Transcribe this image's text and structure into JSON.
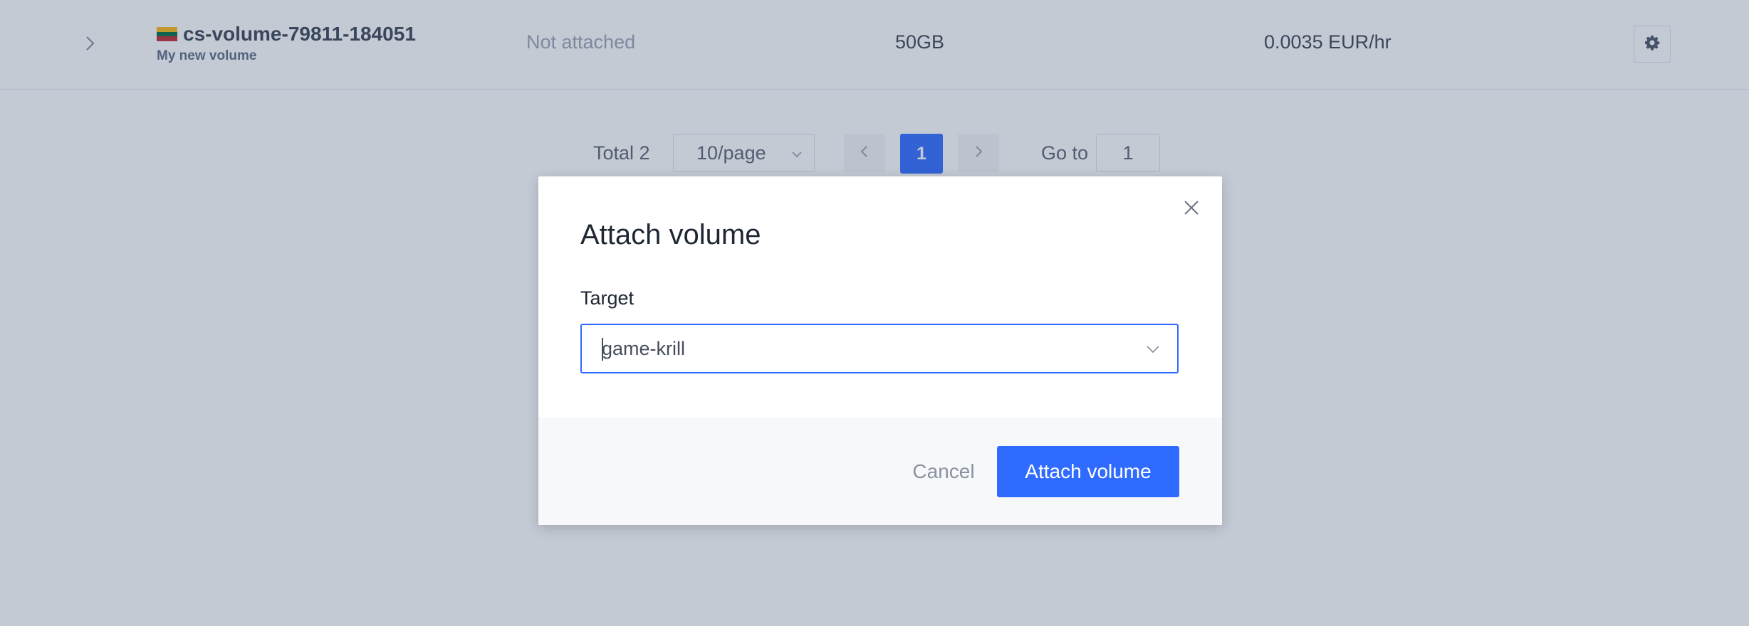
{
  "volume_row": {
    "name": "cs-volume-79811-184051",
    "description": "My new volume",
    "status": "Not attached",
    "size": "50GB",
    "price": "0.0035 EUR/hr",
    "flag_colors": [
      "#fdb913",
      "#006a44",
      "#c1272d"
    ]
  },
  "pagination": {
    "total": "Total 2",
    "page_size": "10/page",
    "current_page": "1",
    "goto_label": "Go to",
    "goto_value": "1"
  },
  "modal": {
    "title": "Attach volume",
    "target_label": "Target",
    "target_value": "game-krill",
    "cancel_label": "Cancel",
    "submit_label": "Attach volume"
  },
  "colors": {
    "accent": "#2f6bff",
    "overlay": "rgba(60, 78, 112, 0.30)"
  },
  "icons": {
    "expand": "chevron-right-icon",
    "settings": "gear-icon",
    "close": "close-icon",
    "dropdown": "chevron-down-icon"
  }
}
